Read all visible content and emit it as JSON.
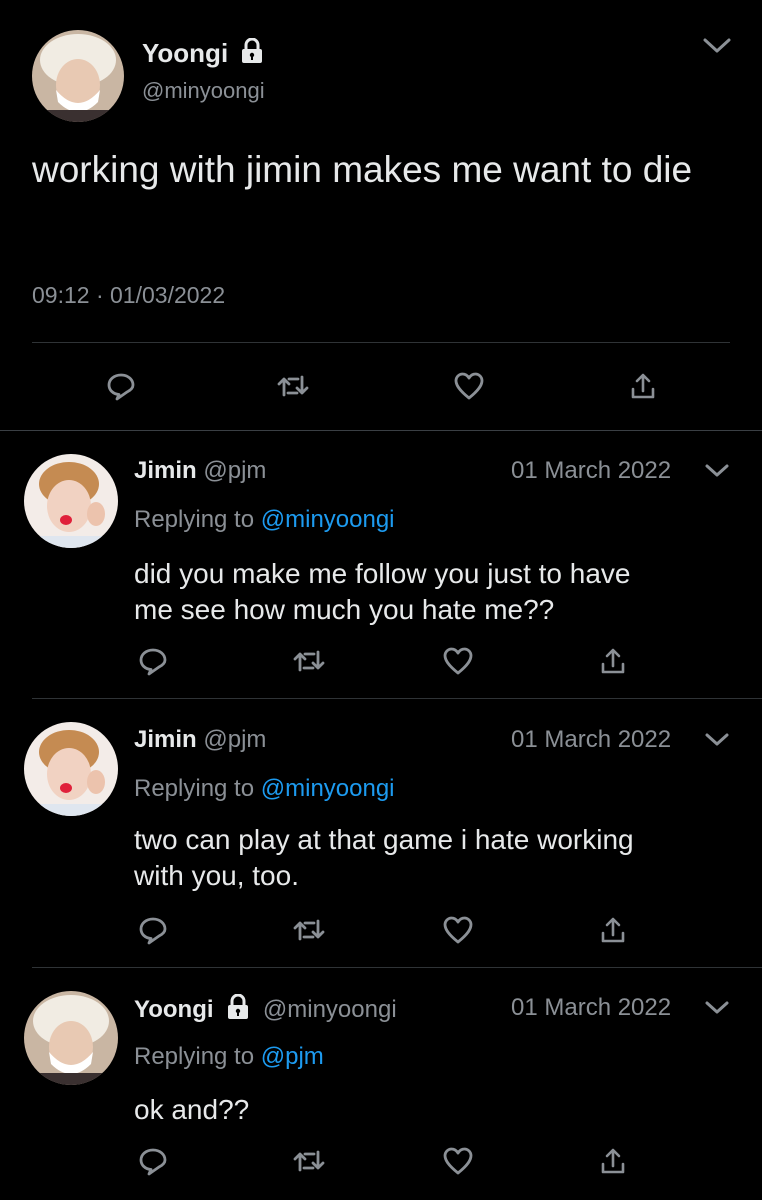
{
  "main_tweet": {
    "display_name": "Yoongi",
    "handle": "@minyoongi",
    "text": "working with jimin makes me want to die",
    "time": "09:12",
    "separator": "·",
    "date": "01/03/2022"
  },
  "replies": [
    {
      "display_name": "Jimin",
      "handle": "@pjm",
      "date": "01 March 2022",
      "replying_label": "Replying to",
      "replying_to": "@minyoongi",
      "text_line1": "did you make me follow you just to have",
      "text_line2": "me see how much you hate me??"
    },
    {
      "display_name": "Jimin",
      "handle": "@pjm",
      "date": "01 March 2022",
      "replying_label": "Replying to",
      "replying_to": "@minyoongi",
      "text_line1": "two can play at that game i hate working",
      "text_line2": "with you, too."
    },
    {
      "display_name": "Yoongi",
      "handle": "@minyoongi",
      "date": "01 March 2022",
      "replying_label": "Replying to",
      "replying_to": "@pjm",
      "text_line1": "ok and??",
      "text_line2": ""
    }
  ],
  "icons": [
    "reply-icon",
    "retweet-icon",
    "like-icon",
    "share-icon",
    "chevron-down-icon",
    "lock-icon"
  ],
  "colors": {
    "background": "#000000",
    "text": "#e7e9ea",
    "muted": "#8b9096",
    "link": "#1d9bf0"
  }
}
